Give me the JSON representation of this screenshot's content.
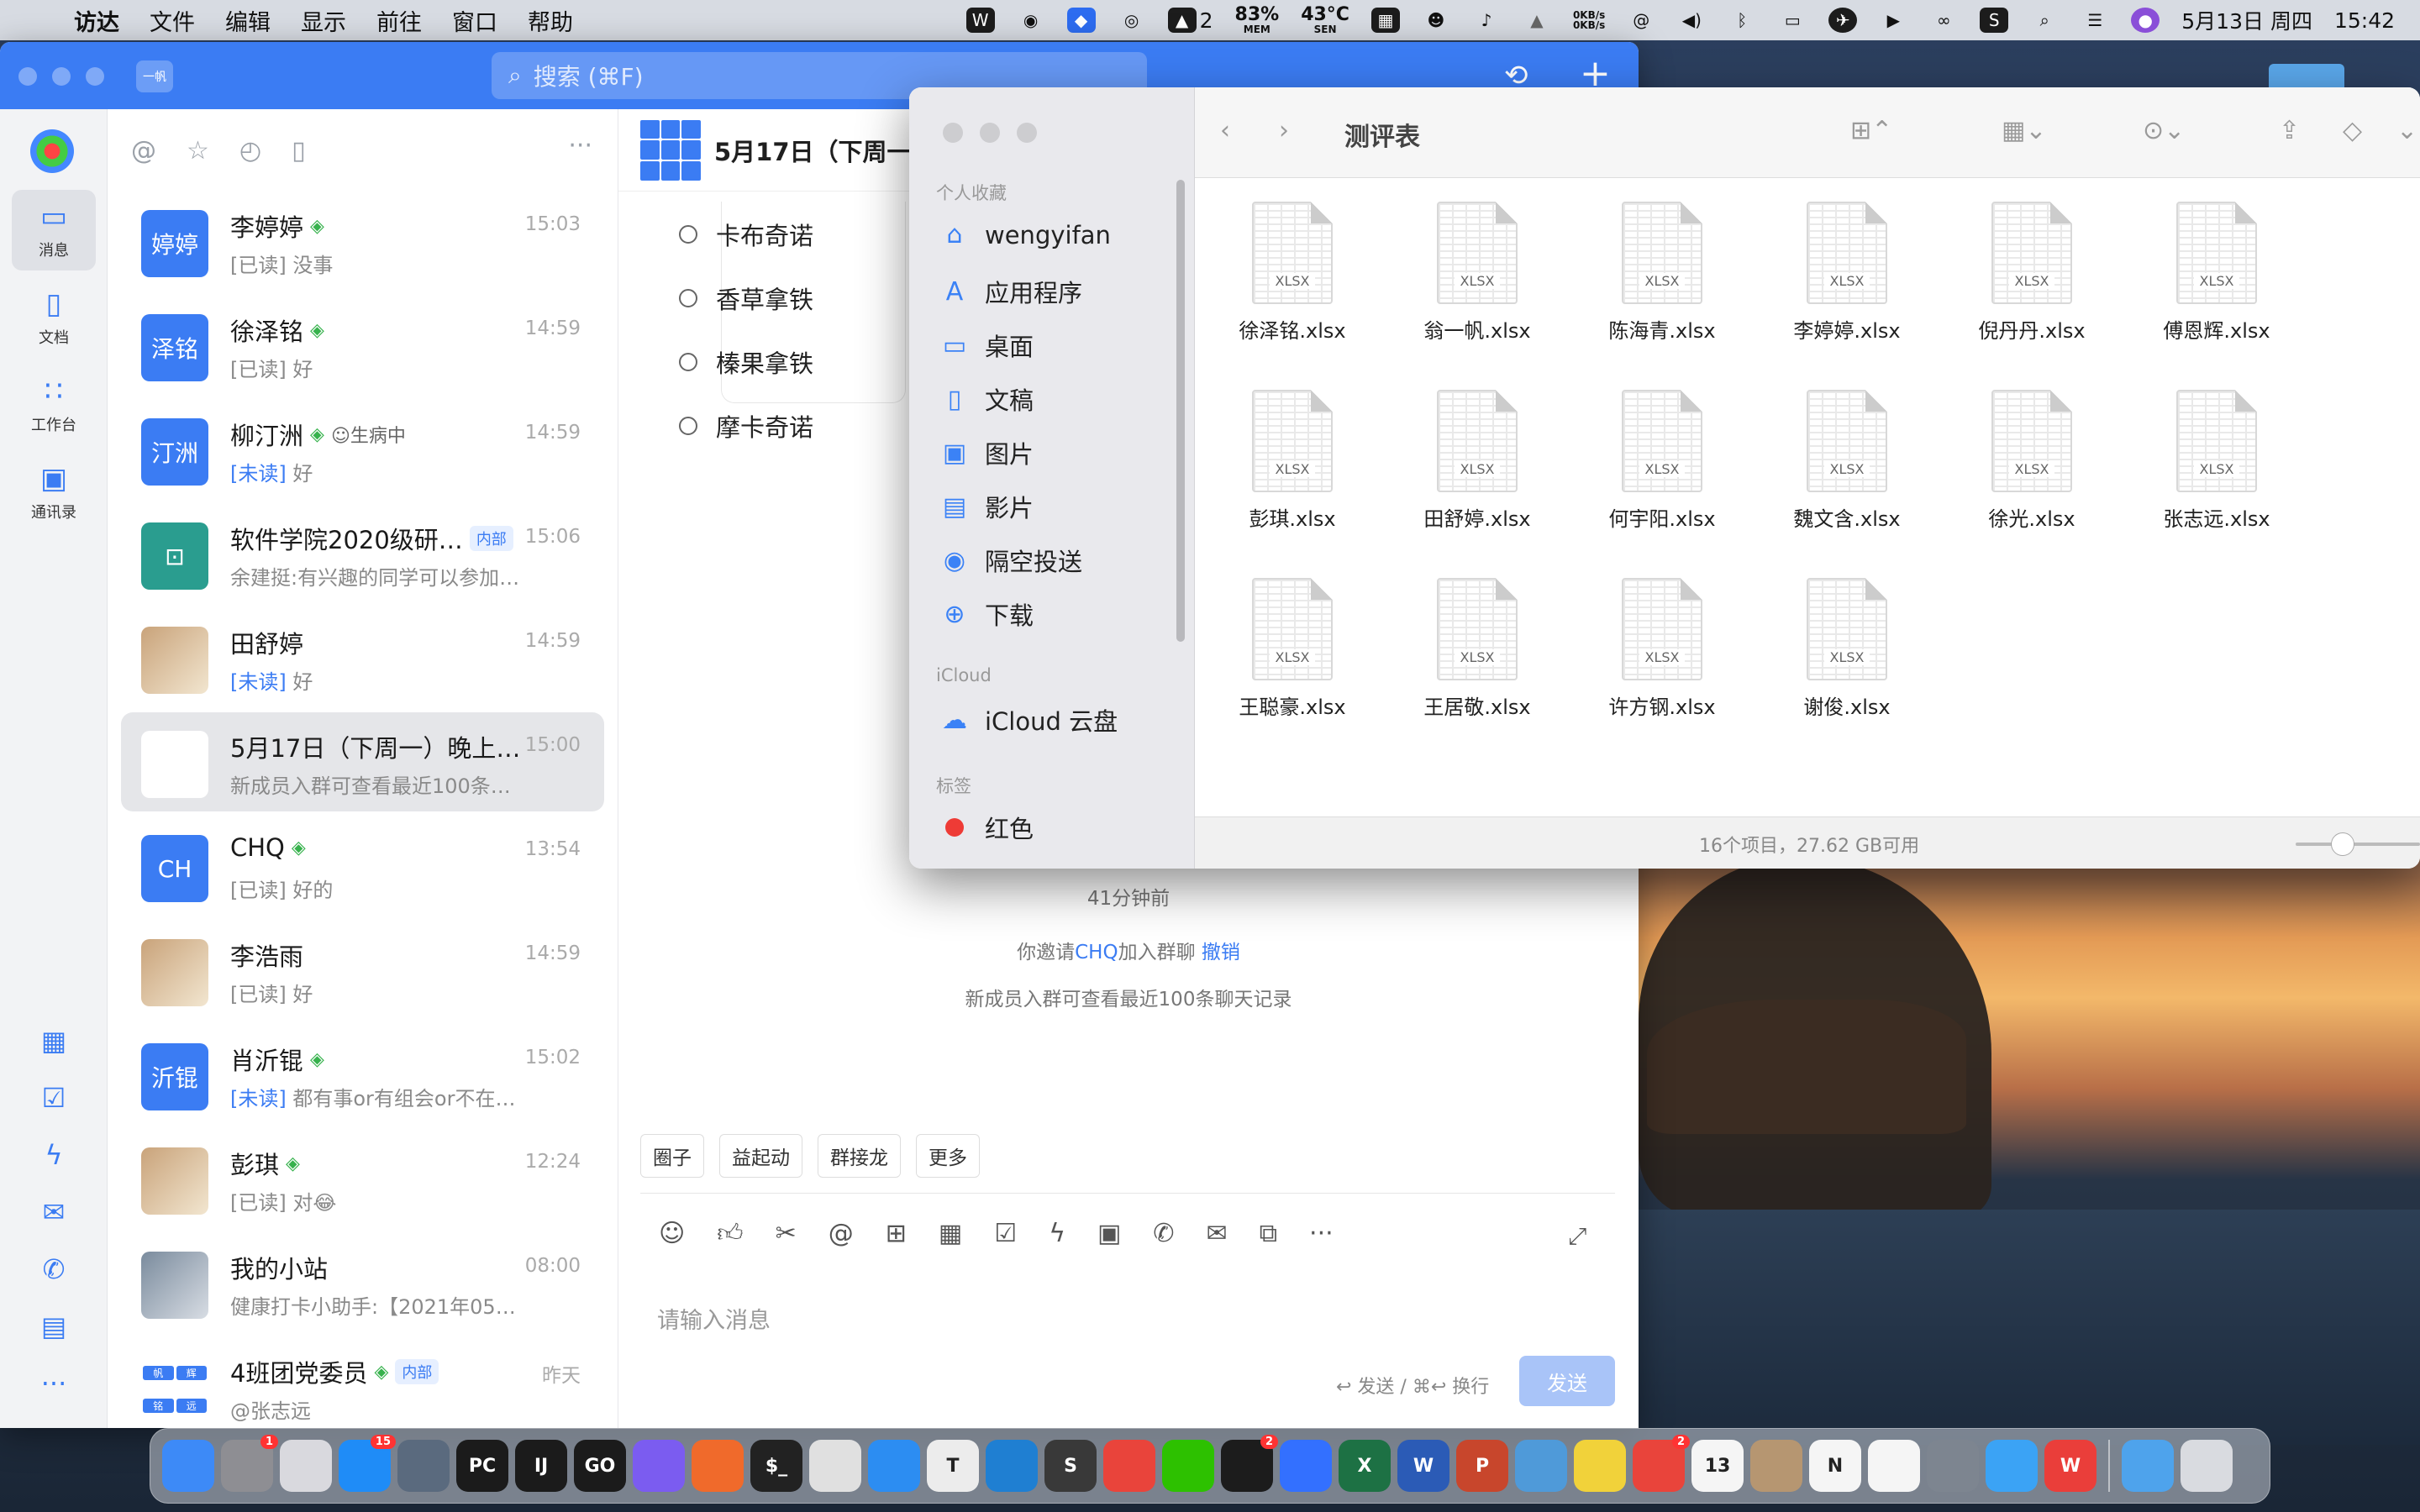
{
  "menubar": {
    "app": "访达",
    "items": [
      "文件",
      "编辑",
      "显示",
      "前往",
      "窗口",
      "帮助"
    ],
    "status": {
      "wps_badge": "2",
      "mem_value": "83%",
      "mem_label": "MEM",
      "temp_value": "43°C",
      "temp_label": "SEN",
      "net_up": "0KB/s",
      "net_down": "0KB/s",
      "date": "5月13日 周四",
      "time": "15:42"
    }
  },
  "dingtalk": {
    "workspace_badge": "一帆",
    "search_placeholder": "搜索 (⌘F)",
    "rail": [
      {
        "label": "消息",
        "icon": "message-icon"
      },
      {
        "label": "文档",
        "icon": "doc-icon"
      },
      {
        "label": "工作台",
        "icon": "workbench-icon"
      },
      {
        "label": "通讯录",
        "icon": "contacts-icon"
      }
    ],
    "conversations": [
      {
        "avatar": "婷婷",
        "name": "李婷婷",
        "verified": true,
        "time": "15:03",
        "read": "[已读]",
        "preview": " 没事"
      },
      {
        "avatar": "泽铭",
        "name": "徐泽铭",
        "verified": true,
        "time": "14:59",
        "read": "[已读]",
        "preview": " 好"
      },
      {
        "avatar": "汀洲",
        "name": "柳汀洲",
        "verified": true,
        "status": "☺生病中",
        "time": "14:59",
        "unread": "[未读]",
        "preview": " 好"
      },
      {
        "avatar": "",
        "name": "软件学院2020级研…",
        "tag": "内部",
        "time": "15:06",
        "preview": "余建挺:有兴趣的同学可以参加…"
      },
      {
        "avatar": "",
        "name": "田舒婷",
        "time": "14:59",
        "unread": "[未读]",
        "preview": " 好"
      },
      {
        "avatar": "",
        "name": "5月17日（下周一）晚上…",
        "time": "15:00",
        "preview": "新成员入群可查看最近100条…"
      },
      {
        "avatar": "CH",
        "name": "CHQ",
        "verified": true,
        "time": "13:54",
        "read": "[已读]",
        "preview": " 好的"
      },
      {
        "avatar": "",
        "name": "李浩雨",
        "time": "14:59",
        "read": "[已读]",
        "preview": " 好"
      },
      {
        "avatar": "沂锟",
        "name": "肖沂锟",
        "verified": true,
        "time": "15:02",
        "unread": "[未读]",
        "preview": " 都有事or有组会or不在…"
      },
      {
        "avatar": "",
        "name": "彭琪",
        "verified": true,
        "time": "12:24",
        "read": "[已读]",
        "preview": " 对😂"
      },
      {
        "avatar": "",
        "name": "我的小站",
        "time": "08:00",
        "preview": "健康打卡小助手:【2021年05…"
      },
      {
        "avatar": "",
        "name": "4班团党委员",
        "verified": true,
        "tag": "内部",
        "time": "昨天",
        "preview": "@张志远"
      }
    ],
    "group_avatar_chars": [
      "帆",
      "辉",
      "铭",
      "远"
    ],
    "chat": {
      "title": "5月17日（下周一）",
      "options": [
        "卡布奇诺",
        "香草拿铁",
        "榛果拿铁",
        "摩卡奇诺"
      ],
      "sys_time": "41分钟前",
      "invite_prefix": "你邀请",
      "invite_user": "CHQ",
      "invite_suffix": "加入群聊",
      "invite_undo": "撤销",
      "history_note": "新成员入群可查看最近100条聊天记录",
      "quick_actions": [
        "圈子",
        "益起动",
        "群接龙",
        "更多"
      ],
      "input_placeholder": "请输入消息",
      "send_hint": "↩ 发送 / ⌘↩ 换行",
      "send_label": "发送"
    }
  },
  "finder": {
    "title": "测评表",
    "sections": {
      "favorites": "个人收藏",
      "icloud": "iCloud",
      "tags": "标签"
    },
    "favorites": [
      {
        "label": "wengyifan",
        "icon": "home-icon"
      },
      {
        "label": "应用程序",
        "icon": "applications-icon"
      },
      {
        "label": "桌面",
        "icon": "desktop-icon"
      },
      {
        "label": "文稿",
        "icon": "document-icon"
      },
      {
        "label": "图片",
        "icon": "photos-icon"
      },
      {
        "label": "影片",
        "icon": "movies-icon"
      },
      {
        "label": "隔空投送",
        "icon": "airdrop-icon"
      },
      {
        "label": "下载",
        "icon": "download-icon"
      }
    ],
    "icloud_items": [
      {
        "label": "iCloud 云盘",
        "icon": "cloud-icon"
      }
    ],
    "tag_items": [
      {
        "label": "红色",
        "color": "#ee3b36"
      }
    ],
    "file_badge": "XLSX",
    "files": [
      "徐泽铭.xlsx",
      "翁一帆.xlsx",
      "陈海青.xlsx",
      "李婷婷.xlsx",
      "倪丹丹.xlsx",
      "傅恩辉.xlsx",
      "彭琪.xlsx",
      "田舒婷.xlsx",
      "何宇阳.xlsx",
      "魏文含.xlsx",
      "徐光.xlsx",
      "张志远.xlsx",
      "王聪豪.xlsx",
      "王居敬.xlsx",
      "许方钢.xlsx",
      "谢俊.xlsx"
    ],
    "status": "16个项目，27.62 GB可用"
  },
  "dock": {
    "apps": [
      {
        "name": "Finder",
        "label": "",
        "color": "#3d8af7"
      },
      {
        "name": "System Preferences",
        "label": "",
        "color": "#8e8e93",
        "badge": "1"
      },
      {
        "name": "Launchpad",
        "label": "",
        "color": "#d9d9de"
      },
      {
        "name": "App Store",
        "label": "",
        "color": "#1f8cf7",
        "badge": "15"
      },
      {
        "name": "Screen",
        "label": "",
        "color": "#5a6a7e"
      },
      {
        "name": "PyCharm",
        "label": "PC",
        "color": "#1b1b1b"
      },
      {
        "name": "IntelliJ IDEA",
        "label": "IJ",
        "color": "#1b1b1b"
      },
      {
        "name": "GoLand",
        "label": "GO",
        "color": "#1b1b1b"
      },
      {
        "name": "Arc",
        "label": "",
        "color": "#7b5cf0"
      },
      {
        "name": "Postman",
        "label": "",
        "color": "#f06a2b"
      },
      {
        "name": "Terminal",
        "label": "$_",
        "color": "#222"
      },
      {
        "name": "Chrome",
        "label": "",
        "color": "#e0e0e0"
      },
      {
        "name": "Safari",
        "label": "",
        "color": "#2c8df2"
      },
      {
        "name": "Typora",
        "label": "T",
        "color": "#ececec"
      },
      {
        "name": "VS Code",
        "label": "",
        "color": "#1f7fd2"
      },
      {
        "name": "Sublime Text",
        "label": "S",
        "color": "#393939"
      },
      {
        "name": "XMind",
        "label": "",
        "color": "#e9443b"
      },
      {
        "name": "WeChat",
        "label": "",
        "color": "#2dc100"
      },
      {
        "name": "QQ",
        "label": "",
        "color": "#1c1c1c",
        "badge": "2"
      },
      {
        "name": "Feishu",
        "label": "",
        "color": "#3370ff"
      },
      {
        "name": "Excel",
        "label": "X",
        "color": "#1d7144"
      },
      {
        "name": "Word",
        "label": "W",
        "color": "#2b5bb6"
      },
      {
        "name": "PowerPoint",
        "label": "P",
        "color": "#c8462c"
      },
      {
        "name": "Network Utility",
        "label": "",
        "color": "#4f9ad9"
      },
      {
        "name": "Lemon",
        "label": "",
        "color": "#f1d23a"
      },
      {
        "name": "Meter",
        "label": "",
        "color": "#e9443b",
        "badge": "2"
      },
      {
        "name": "Calendar",
        "label": "13",
        "color": "#f5f5f5"
      },
      {
        "name": "Archive",
        "label": "",
        "color": "#b69671"
      },
      {
        "name": "Notion",
        "label": "N",
        "color": "#f5f5f5"
      },
      {
        "name": "Reminders",
        "label": "",
        "color": "#f5f5f5"
      },
      {
        "name": "Utility",
        "label": "",
        "color": "#7d8590"
      },
      {
        "name": "DingTalk Search",
        "label": "",
        "color": "#3ba3f5"
      },
      {
        "name": "WPS",
        "label": "W",
        "color": "#ea3e3a"
      },
      {
        "name": "Downloads",
        "label": "",
        "color": "#4ea3ec"
      },
      {
        "name": "Trash",
        "label": "",
        "color": "#d9dbe0"
      }
    ]
  }
}
